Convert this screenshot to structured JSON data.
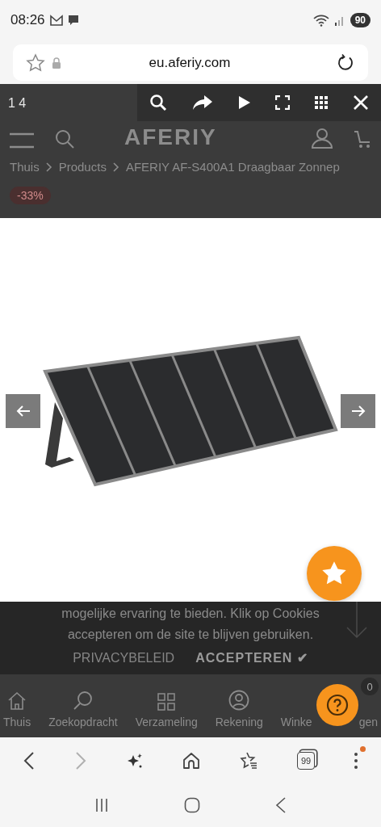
{
  "status_bar": {
    "time": "08:26",
    "battery": "90"
  },
  "address_bar": {
    "url": "eu.aferiy.com"
  },
  "page": {
    "logo": "AFERIY",
    "breadcrumb": [
      "Thuis",
      "Products",
      "AFERIY AF-S400A1 Draagbaar Zonnep"
    ],
    "discount_badge": "-33%"
  },
  "lightbox": {
    "counter": "1 4"
  },
  "cookie_banner": {
    "text_lines": [
      "mogelijke ervaring te bieden. Klik op Cookies",
      "accepteren om de site te blijven gebruiken."
    ],
    "privacy_link": "PRIVACYBELEID",
    "accept_button": "ACCEPTEREN ✔"
  },
  "bottom_nav": {
    "items": [
      {
        "kind": "home",
        "label": "Thuis"
      },
      {
        "kind": "search",
        "label": "Zoekopdracht"
      },
      {
        "kind": "grid",
        "label": "Verzameling"
      },
      {
        "kind": "account",
        "label": "Rekening"
      },
      {
        "kind": "cart",
        "label": "Winke",
        "label_tail": "gen"
      }
    ],
    "cart_count": "0"
  },
  "browser_toolbar": {
    "forward_disabled": true,
    "tabs_count": "99",
    "menu_notification": true
  }
}
